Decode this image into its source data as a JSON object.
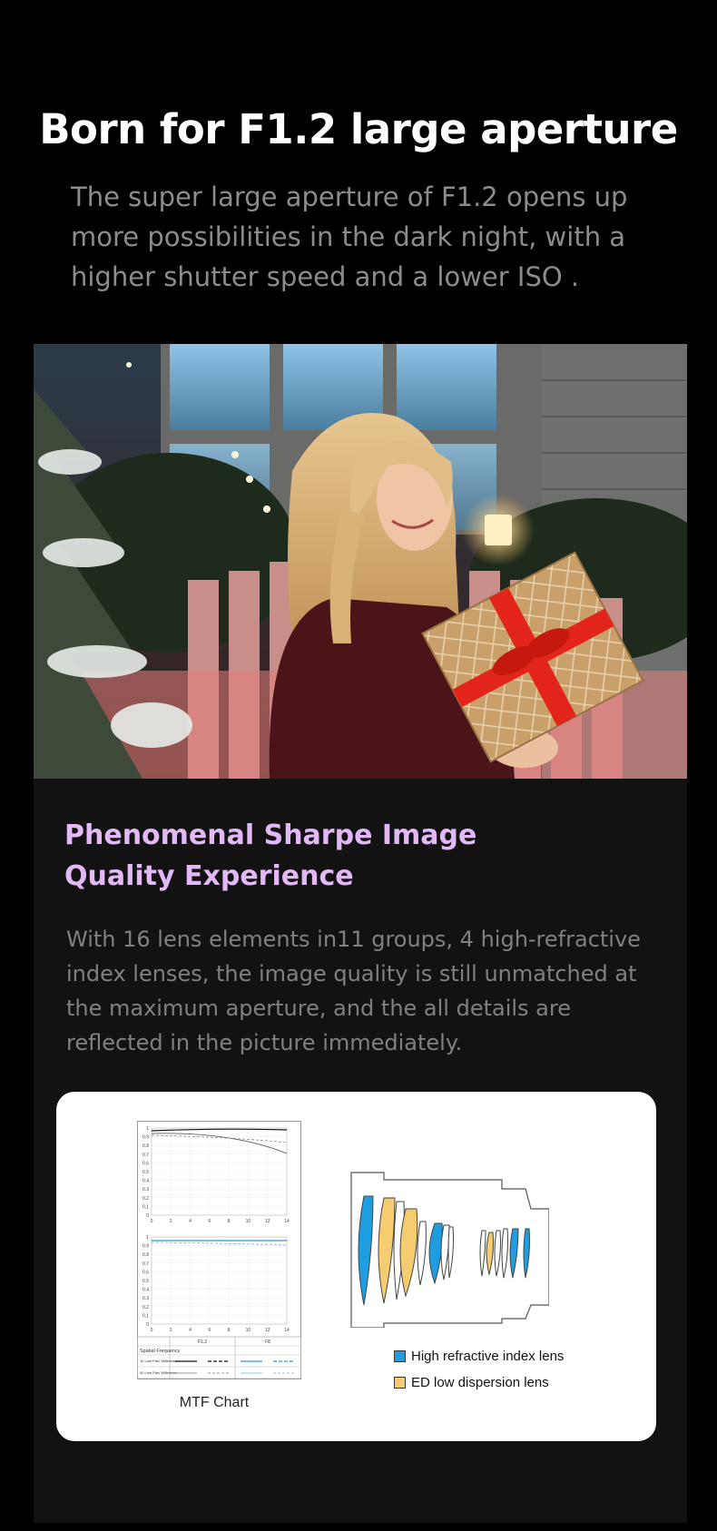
{
  "hero": {
    "title": "Born for F1.2 large aperture",
    "subtitle_lines": [
      "The super large aperture of F1.2 opens up",
      "more possibilities in the dark night, with a",
      "higher shutter speed and a lower ISO ."
    ]
  },
  "photo": {
    "description_icon": "portrait-photo"
  },
  "feature": {
    "title_lines": [
      "Phenomenal Sharpe Image",
      "Quality Experience"
    ],
    "desc_lines": [
      "With 16 lens elements in11 groups, 4 high-refractive",
      "index lenses, the image quality is still unmatched at",
      "the maximum aperture, and the all details are",
      "reflected in the picture immediately."
    ]
  },
  "mtf": {
    "label": "MTF Chart",
    "y_ticks": [
      "1",
      "0.9",
      "0.8",
      "0.7",
      "0.6",
      "0.5",
      "0.4",
      "0.3",
      "0.2",
      "0.1",
      "0"
    ],
    "x_ticks": [
      "0",
      "2",
      "4",
      "6",
      "8",
      "10",
      "12",
      "14"
    ],
    "table_header": [
      "F1.2",
      "F8"
    ],
    "table_row_label": "Spatial Frequency",
    "table_rows": [
      "10 Line Pair/ Millimeter",
      "30 Line Pair/ Millimeter"
    ]
  },
  "legend": {
    "items": [
      {
        "label": "High refractive index lens",
        "color": "#1e9ee0"
      },
      {
        "label": "ED low dispersion lens",
        "color": "#f5cc70"
      }
    ]
  },
  "colors": {
    "accent_purple": "#e3b8f7",
    "lens_blue": "#1e9ee0",
    "lens_yellow": "#f5cc70"
  }
}
